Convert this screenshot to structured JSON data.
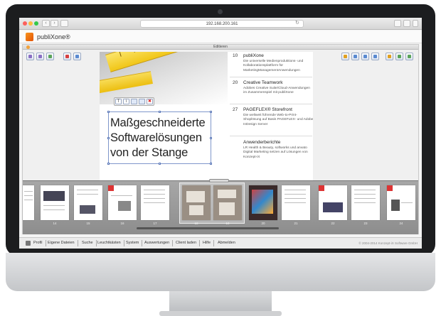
{
  "browser": {
    "url": "192.168.200.161",
    "nav_back": "‹",
    "nav_forward": "›",
    "reload": "↻"
  },
  "app": {
    "name": "publiXone®",
    "accent": "#f7941d"
  },
  "editor": {
    "title": "Editieren"
  },
  "page": {
    "headline_lines": [
      "Maßgeschneiderte",
      "Softwarelösungen",
      "von der Stange"
    ],
    "context_toolbar": [
      "T",
      "i",
      "",
      "",
      "✖"
    ],
    "toc": [
      {
        "num": "10",
        "title": "publiXone",
        "body": "Die universelle Medienproduktions- und Kollaborationsplattform für MarketingManagementAnwendungen"
      },
      {
        "num": "20",
        "title": "Creative Teamwork",
        "body": "Adobes Creative Suite/Cloud-Anwendungen im Zusammenspiel mit publiXone"
      },
      {
        "num": "27",
        "title": "PAGEFLEX® Storefront",
        "body": "Die weltweit führende Web-to-Print-Shoplösung auf Basis PAGEFLEX- und Adobe InDesign Server"
      },
      {
        "num": "",
        "title": "Anwenderberichte",
        "body": "LR Health & Beauty, softworks und anvato Digital Marketing setzen auf Lösungen von Konzept-iX"
      }
    ]
  },
  "filmstrip": {
    "page_numbers": [
      "",
      "14",
      "15",
      "16",
      "17",
      "18",
      "19",
      "20",
      "21",
      "22",
      "23",
      "24",
      "25"
    ]
  },
  "footer": {
    "items": [
      "Profil",
      "Eigene Dateien",
      "Suche",
      "Leuchtkästen",
      "System",
      "Auswertungen",
      "Client laden",
      "Hilfe",
      "Abmelden"
    ],
    "copyright": "© 2004-2014 Konzept-iX Software GmbH"
  }
}
